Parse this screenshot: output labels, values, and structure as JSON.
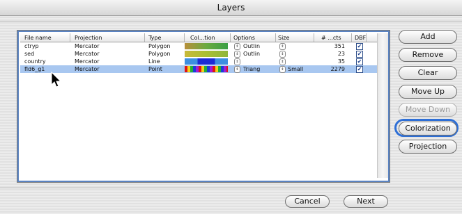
{
  "window": {
    "title": "Layers"
  },
  "table": {
    "columns": [
      "File name",
      "Projection",
      "Type",
      "Col...tion",
      "Options",
      "Size",
      "# ...cts",
      "DBF"
    ],
    "rows": [
      {
        "file": "ctryp",
        "projection": "Mercator",
        "type": "Polygon",
        "options": "Outlin",
        "size": "",
        "count": "351",
        "dbf": "✔",
        "selected": false,
        "colorization": "green-gradient"
      },
      {
        "file": "sed",
        "projection": "Mercator",
        "type": "Polygon",
        "options": "Outlin",
        "size": "",
        "count": "23",
        "dbf": "✔",
        "selected": false,
        "colorization": "yellow-gradient"
      },
      {
        "file": "country",
        "projection": "Mercator",
        "type": "Line",
        "options": "",
        "size": "",
        "count": "35",
        "dbf": "✔",
        "selected": false,
        "colorization": "blue-bar"
      },
      {
        "file": "fld6_g1",
        "projection": "Mercator",
        "type": "Point",
        "options": "Triang",
        "size": "Small",
        "count": "2279",
        "dbf": "✔",
        "selected": true,
        "colorization": "multicolor"
      }
    ]
  },
  "sidebar_buttons": [
    {
      "label": "Add",
      "enabled": true
    },
    {
      "label": "Remove",
      "enabled": true
    },
    {
      "label": "Clear",
      "enabled": true
    },
    {
      "label": "Move Up",
      "enabled": true
    },
    {
      "label": "Move Down",
      "enabled": false
    },
    {
      "label": "Colorization",
      "enabled": true
    },
    {
      "label": "Projection",
      "enabled": true
    }
  ],
  "footer_buttons": {
    "cancel": "Cancel",
    "next": "Next"
  },
  "colors": {
    "selection": "#a8c7f0",
    "focus_ring": "#2e6fd6",
    "table_border": "#5a83c2"
  },
  "icons": {
    "stepper": "up-down-stepper-icon",
    "checkbox": "checkbox-checked-icon",
    "cursor": "arrow-cursor-icon"
  }
}
